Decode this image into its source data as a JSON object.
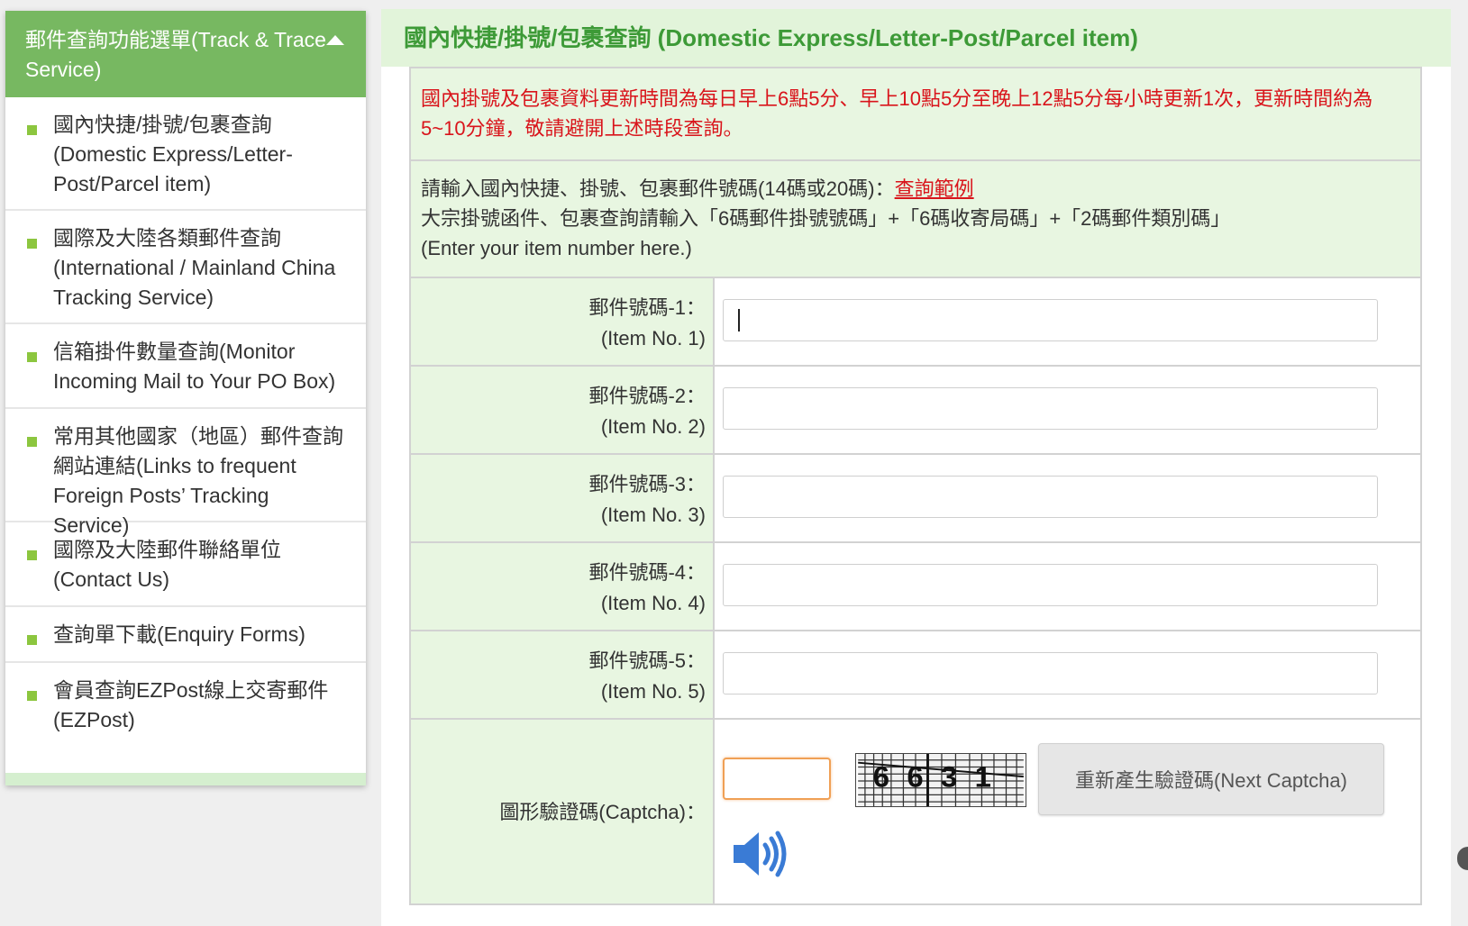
{
  "sidebar": {
    "title": "郵件查詢功能選單(Track & Trace Service)",
    "items": [
      {
        "label": "國內快捷/掛號/包裹查詢(Domestic Express/Letter-Post/Parcel item)"
      },
      {
        "label": "國際及大陸各類郵件查詢(International / Mainland China Tracking Service)"
      },
      {
        "label": "信箱掛件數量查詢(Monitor Incoming Mail to Your PO Box)"
      },
      {
        "label": "常用其他國家（地區）郵件查詢網站連結(Links to frequent Foreign Posts’ Tracking Service)"
      },
      {
        "label": "國際及大陸郵件聯絡單位(Contact Us)"
      },
      {
        "label": "查詢單下載(Enquiry Forms)"
      },
      {
        "label": "會員查詢EZPost線上交寄郵件(EZPost)"
      }
    ],
    "icons": {
      "collapse": "chevron-up-icon",
      "bullet": "square-bullet-icon"
    },
    "colors": {
      "header_bg": "#77b861",
      "bullet": "#8cc63f"
    }
  },
  "main": {
    "title": "國內快捷/掛號/包裹查詢 (Domestic Express/Letter-Post/Parcel item)",
    "notice": "國內掛號及包裹資料更新時間為每日早上6點5分、早上10點5分至晚上12點5分每小時更新1次，更新時間約為5~10分鐘，敬請避開上述時段查詢。",
    "intro": {
      "line1": "請輸入國內快捷、掛號、包裹郵件號碼(14碼或20碼)：",
      "example_link": "查詢範例",
      "line2": "大宗掛號函件、包裹查詢請輸入「6碼郵件掛號號碼」+「6碼收寄局碼」+「2碼郵件類別碼」",
      "line3": "(Enter your item number here.)"
    },
    "fields": [
      {
        "label_zh": "郵件號碼-1：",
        "label_en": "(Item No. 1)",
        "value": ""
      },
      {
        "label_zh": "郵件號碼-2：",
        "label_en": "(Item No. 2)",
        "value": ""
      },
      {
        "label_zh": "郵件號碼-3：",
        "label_en": "(Item No. 3)",
        "value": ""
      },
      {
        "label_zh": "郵件號碼-4：",
        "label_en": "(Item No. 4)",
        "value": ""
      },
      {
        "label_zh": "郵件號碼-5：",
        "label_en": "(Item No. 5)",
        "value": ""
      }
    ],
    "captcha": {
      "label": "圖形驗證碼(Captcha)：",
      "value": "",
      "image_text": "6631",
      "refresh_label": "重新產生驗證碼(Next Captcha)",
      "audio_icon": "speaker-icon"
    },
    "colors": {
      "title": "#3d9a37",
      "notice": "#d9141b",
      "label_bg": "#e8f6e1"
    }
  }
}
